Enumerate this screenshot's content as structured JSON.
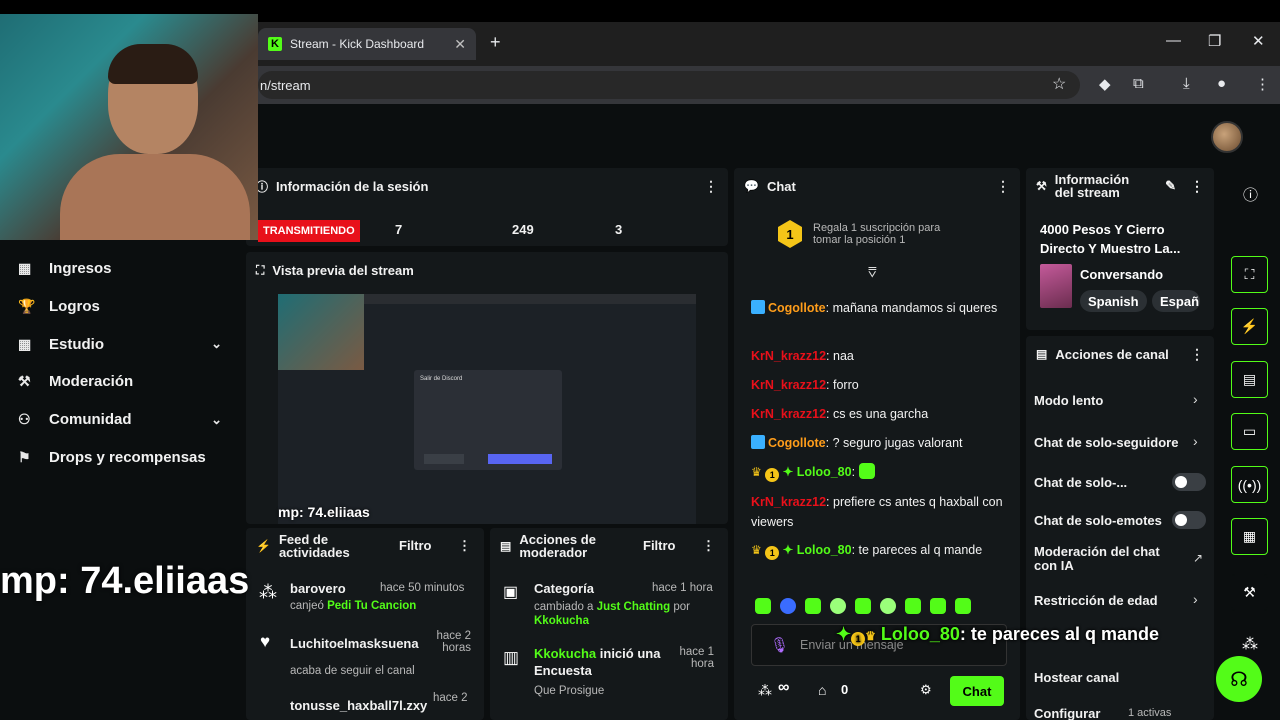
{
  "browser": {
    "tab_title": "Stream - Kick Dashboard",
    "url": "n/stream",
    "tab_close": "✕",
    "new_tab": "+",
    "window_controls": [
      "—",
      "❐",
      "✕"
    ]
  },
  "webcam_caption": "mp: 74.eliiaas",
  "sidebar": {
    "items": [
      {
        "label": "Ingresos",
        "icon": "chart-icon"
      },
      {
        "label": "Logros",
        "icon": "trophy-icon"
      },
      {
        "label": "Estudio",
        "icon": "studio-icon",
        "expandable": true
      },
      {
        "label": "Moderación",
        "icon": "wrench-icon"
      },
      {
        "label": "Comunidad",
        "icon": "people-icon",
        "expandable": true
      },
      {
        "label": "Drops y recompensas",
        "icon": "gift-icon"
      }
    ]
  },
  "session": {
    "title": "Información de la sesión",
    "status": "TRANSMITIENDO",
    "stats": [
      "7",
      "249",
      "3"
    ]
  },
  "preview": {
    "title": "Vista previa del stream",
    "label": "mp: 74.eliiaas",
    "dialog_title": "Salir de Discord"
  },
  "activity": {
    "title": "Feed de actividades",
    "filter": "Filtro",
    "items": [
      {
        "name": "barovero",
        "time": "hace 50 minutos",
        "action": "canjeó",
        "highlight": "Pedi Tu Cancion"
      },
      {
        "name": "Luchitoelmasksuena",
        "time": "hace 2 horas",
        "action": "acaba de seguir el canal"
      },
      {
        "name": "tonusse_haxball7l.zxy",
        "time": "hace 2"
      }
    ]
  },
  "modactions": {
    "title": "Acciones de moderador",
    "filter": "Filtro",
    "items": [
      {
        "title": "Categoría",
        "time": "hace 1 hora",
        "pre": "cambiado a",
        "highlight": "Just Chatting",
        "mid": "por",
        "by": "Kkokucha"
      },
      {
        "user": "Kkokucha",
        "text": "inició una Encuesta",
        "time": "hace 1 hora",
        "sub": "Que Prosigue"
      }
    ]
  },
  "chat": {
    "title": "Chat",
    "gift_prompt": "Regala 1 suscripción para tomar la posición 1",
    "gift_rank": "1",
    "messages": [
      {
        "user": "Cogollote",
        "text": ": mañana mandamos si queres",
        "color": "orange"
      },
      {
        "user": "KrN_krazz12",
        "text": ": naa",
        "color": "red"
      },
      {
        "user": "KrN_krazz12",
        "text": ": forro",
        "color": "red"
      },
      {
        "user": "KrN_krazz12",
        "text": ": cs es una garcha",
        "color": "red"
      },
      {
        "user": "Cogollote",
        "text": ": ? seguro jugas valorant",
        "color": "orange"
      },
      {
        "user": "Loloo_80",
        "text": ":",
        "color": "green"
      },
      {
        "user": "KrN_krazz12",
        "text": ": prefiere cs antes q haxball con viewers",
        "color": "red"
      },
      {
        "user": "Loloo_80",
        "text": ": te pareces al q mande",
        "color": "green"
      }
    ],
    "input_placeholder": "Enviar un mensaje",
    "send_label": "Chat",
    "infinity": "∞",
    "count": "0",
    "overlay_user": "Loloo_80",
    "overlay_text": ": te pareces al q mande"
  },
  "channel_info": {
    "title": "Información del stream",
    "stream_title": "4000 Pesos Y Cierro Directo Y Muestro La...",
    "category": "Conversando",
    "tags": [
      "Spanish",
      "Españ"
    ]
  },
  "channel_actions": {
    "title": "Acciones de canal",
    "items": [
      {
        "label": "Modo lento",
        "control": "chevron"
      },
      {
        "label": "Chat de solo-seguidore",
        "control": "chevron"
      },
      {
        "label": "Chat de solo-...",
        "control": "toggle"
      },
      {
        "label": "Chat de solo-emotes",
        "control": "toggle"
      },
      {
        "label": "Moderación del chat con IA",
        "control": "external"
      },
      {
        "label": "Restricción de edad",
        "control": "chevron"
      },
      {
        "label": "Hostear canal",
        "control": "none"
      },
      {
        "label": "Configurar",
        "control": "chevron",
        "badge": "1 activas"
      }
    ]
  },
  "colors": {
    "accent": "#53fc18",
    "live": "#e8101a",
    "bg": "#0b0e0f",
    "panel": "#14181a"
  }
}
